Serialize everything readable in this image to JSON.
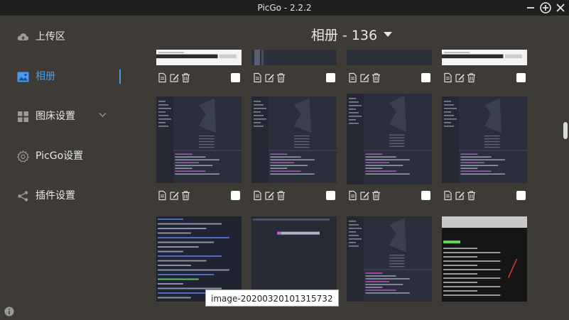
{
  "app": {
    "title": "PicGo - 2.2.2"
  },
  "window_controls": {
    "minimize_icon": "minus-icon",
    "maximize_icon": "plus-circle-icon",
    "close_icon": "close-icon"
  },
  "sidebar": {
    "items": [
      {
        "label": "上传区",
        "icon": "cloud-upload-icon",
        "active": false
      },
      {
        "label": "相册",
        "icon": "image-icon",
        "active": true
      },
      {
        "label": "图床设置",
        "icon": "grid-icon",
        "active": false,
        "has_submenu": true
      },
      {
        "label": "PicGo设置",
        "icon": "gear-icon",
        "active": false
      },
      {
        "label": "插件设置",
        "icon": "share-icon",
        "active": false
      }
    ],
    "info_icon": "info-icon"
  },
  "gallery": {
    "title": "相册 - 136",
    "dropdown_icon": "caret-down-icon",
    "rows": [
      {
        "items": [
          {
            "kind": "ui-light",
            "checked": false
          },
          {
            "kind": "dark-strip",
            "checked": false
          },
          {
            "kind": "dark-plain",
            "checked": false
          },
          {
            "kind": "ui-light",
            "checked": false
          }
        ]
      },
      {
        "items": [
          {
            "kind": "vscode",
            "checked": false
          },
          {
            "kind": "vscode",
            "checked": false
          },
          {
            "kind": "vscode",
            "checked": false
          },
          {
            "kind": "vscode",
            "checked": false
          }
        ]
      },
      {
        "items": [
          {
            "kind": "terminal",
            "checked": false
          },
          {
            "kind": "terminal-dark",
            "checked": false
          },
          {
            "kind": "vscode",
            "checked": false
          },
          {
            "kind": "terminal-green",
            "checked": false
          }
        ]
      }
    ]
  },
  "tooltip": {
    "text": "image-20200320101315732"
  },
  "colors": {
    "accent": "#4a9af5",
    "background": "#3e3b37",
    "titlebar": "#1f1f1f"
  }
}
